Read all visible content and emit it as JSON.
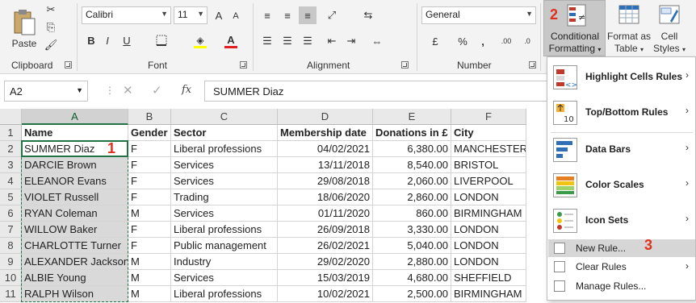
{
  "ribbon": {
    "clipboard": {
      "paste_label": "Paste",
      "group_label": "Clipboard"
    },
    "font": {
      "font_name": "Calibri",
      "font_size": "11",
      "bold": "B",
      "italic": "I",
      "underline": "U",
      "grow": "A",
      "shrink": "A",
      "group_label": "Font"
    },
    "alignment": {
      "group_label": "Alignment"
    },
    "number": {
      "format": "General",
      "currency": "£",
      "percent": "%",
      "comma": ",",
      "group_label": "Number"
    },
    "styles": {
      "conditional_formatting_line1": "Conditional",
      "conditional_formatting_line2": "Formatting",
      "format_as_table_line1": "Format as",
      "format_as_table_line2": "Table",
      "cell_styles_line1": "Cell",
      "cell_styles_line2": "Styles"
    }
  },
  "formula_bar": {
    "name_box": "A2",
    "fx": "fx",
    "content": "SUMMER Diaz"
  },
  "columns": [
    "A",
    "B",
    "C",
    "D",
    "E",
    "F"
  ],
  "rows": [
    {
      "n": "1",
      "cells": [
        "Name",
        "Gender",
        "Sector",
        "Membership date",
        "Donations in £",
        "City"
      ]
    },
    {
      "n": "2",
      "cells": [
        "SUMMER Diaz",
        "F",
        "Liberal professions",
        "04/02/2021",
        "6,380.00",
        "MANCHESTER"
      ]
    },
    {
      "n": "3",
      "cells": [
        "DARCIE Brown",
        "F",
        "Services",
        "13/11/2018",
        "8,540.00",
        "BRISTOL"
      ]
    },
    {
      "n": "4",
      "cells": [
        "ELEANOR Evans",
        "F",
        "Services",
        "29/08/2018",
        "2,060.00",
        "LIVERPOOL"
      ]
    },
    {
      "n": "5",
      "cells": [
        "VIOLET Russell",
        "F",
        "Trading",
        "18/06/2020",
        "2,860.00",
        "LONDON"
      ]
    },
    {
      "n": "6",
      "cells": [
        "RYAN Coleman",
        "M",
        "Services",
        "01/11/2020",
        "860.00",
        "BIRMINGHAM"
      ]
    },
    {
      "n": "7",
      "cells": [
        "WILLOW Baker",
        "F",
        "Liberal professions",
        "26/09/2018",
        "3,330.00",
        "LONDON"
      ]
    },
    {
      "n": "8",
      "cells": [
        "CHARLOTTE Turner",
        "F",
        "Public management",
        "26/02/2021",
        "5,040.00",
        "LONDON"
      ]
    },
    {
      "n": "9",
      "cells": [
        "ALEXANDER Jackson",
        "M",
        "Industry",
        "29/02/2020",
        "2,880.00",
        "LONDON"
      ]
    },
    {
      "n": "10",
      "cells": [
        "ALBIE Young",
        "M",
        "Services",
        "15/03/2019",
        "4,680.00",
        "SHEFFIELD"
      ]
    },
    {
      "n": "11",
      "cells": [
        "RALPH Wilson",
        "M",
        "Liberal professions",
        "10/02/2021",
        "2,500.00",
        "BIRMINGHAM"
      ]
    }
  ],
  "menu": {
    "items": [
      {
        "label": "Highlight Cells Rules",
        "icon": "highlight-cells-icon"
      },
      {
        "label": "Top/Bottom Rules",
        "icon": "top-bottom-icon"
      },
      {
        "label": "Data Bars",
        "icon": "data-bars-icon"
      },
      {
        "label": "Color Scales",
        "icon": "color-scales-icon"
      },
      {
        "label": "Icon Sets",
        "icon": "icon-sets-icon"
      }
    ],
    "new_rule": "New Rule...",
    "clear_rules": "Clear Rules",
    "manage_rules": "Manage Rules..."
  },
  "callouts": {
    "one": "1",
    "two": "2",
    "three": "3"
  },
  "colors": {
    "accent_green": "#217346",
    "callout_red": "#e0301e",
    "selection_gray": "#d9d9d9"
  }
}
